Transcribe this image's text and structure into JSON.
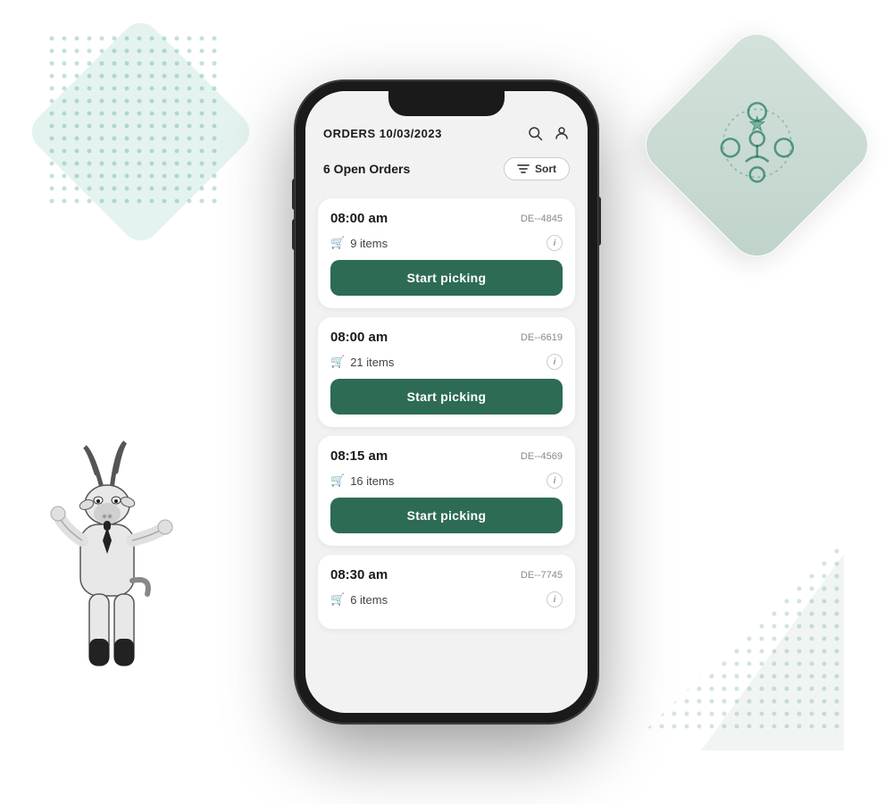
{
  "page": {
    "bg_color": "#ffffff"
  },
  "header": {
    "title": "ORDERS 10/03/2023",
    "search_icon": "search",
    "user_icon": "user"
  },
  "filter_bar": {
    "open_orders_label": "6 Open Orders",
    "sort_label": "Sort"
  },
  "orders": [
    {
      "time": "08:00 am",
      "id": "DE--4845",
      "items": "9 items",
      "button_label": "Start picking"
    },
    {
      "time": "08:00 am",
      "id": "DE--6619",
      "items": "21 items",
      "button_label": "Start picking"
    },
    {
      "time": "08:15 am",
      "id": "DE--4569",
      "items": "16 items",
      "button_label": "Start picking"
    },
    {
      "time": "08:30 am",
      "id": "DE--7745",
      "items": "6 items",
      "button_label": null
    }
  ],
  "colors": {
    "primary_green": "#2d6b55",
    "phone_bg": "#f2f2f2",
    "card_bg": "#ffffff"
  }
}
